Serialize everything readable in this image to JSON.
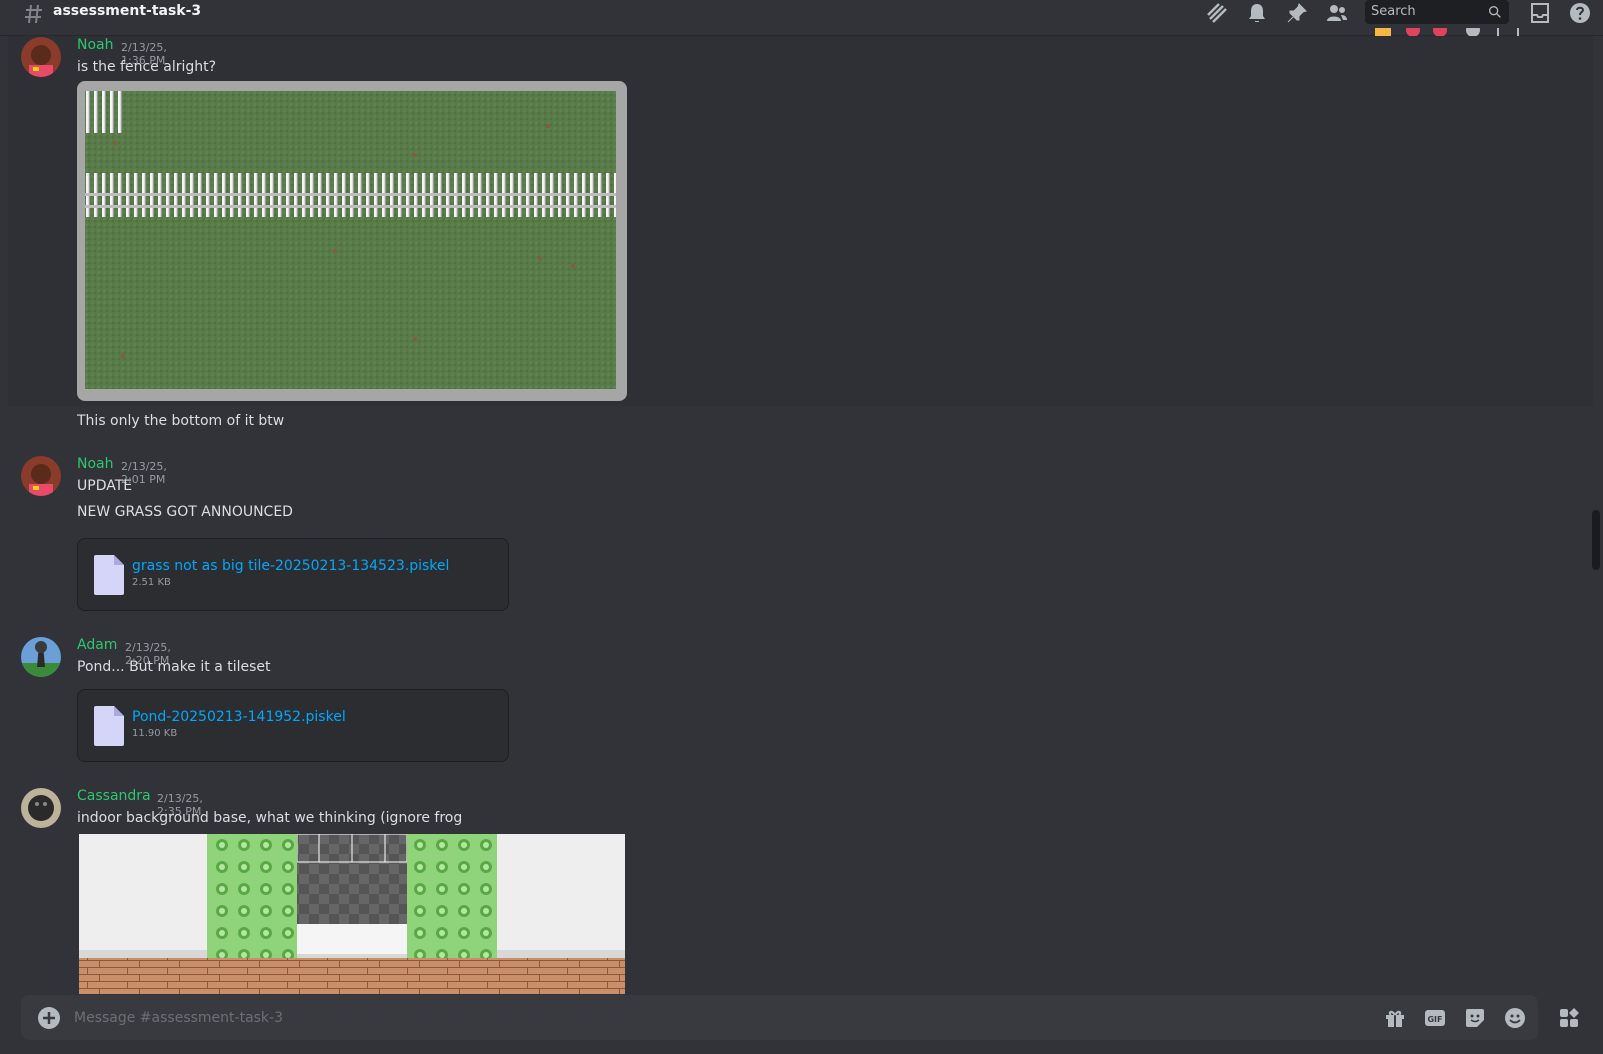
{
  "header": {
    "channel_name": "assessment-task-3",
    "search_placeholder": "Search"
  },
  "messages": [
    {
      "author": "Noah",
      "timestamp": "2/13/25, 1:36 PM",
      "lines": [
        "is the fence alright?"
      ],
      "after_image_text": "This only the bottom of it btw"
    },
    {
      "author": "Noah",
      "timestamp": "2/13/25, 2:01 PM",
      "lines": [
        "UPDATE",
        "NEW GRASS GOT ANNOUNCED"
      ],
      "attachment": {
        "name": "grass not as big tile-20250213-134523.piskel",
        "size": "2.51 KB"
      }
    },
    {
      "author": "Adam",
      "timestamp": "2/13/25, 2:20 PM",
      "lines": [
        "Pond... But make it a tileset"
      ],
      "attachment": {
        "name": "Pond-20250213-141952.piskel",
        "size": "11.90 KB"
      }
    },
    {
      "author": "Cassandra",
      "timestamp": "2/13/25, 2:35 PM",
      "lines": [
        "indoor background base, what we thinking (ignore frog"
      ]
    }
  ],
  "composer": {
    "placeholder": "Message #assessment-task-3"
  },
  "colors": {
    "background": "#313338",
    "username": "#2dc770",
    "link": "#00a8fc",
    "input": "#383a40"
  },
  "icons": [
    "threads-icon",
    "bell-icon",
    "pin-icon",
    "members-icon",
    "search-icon",
    "inbox-icon",
    "help-icon",
    "plus-icon",
    "gift-icon",
    "gif-icon",
    "sticker-icon",
    "emoji-icon",
    "apps-icon",
    "file-icon"
  ]
}
